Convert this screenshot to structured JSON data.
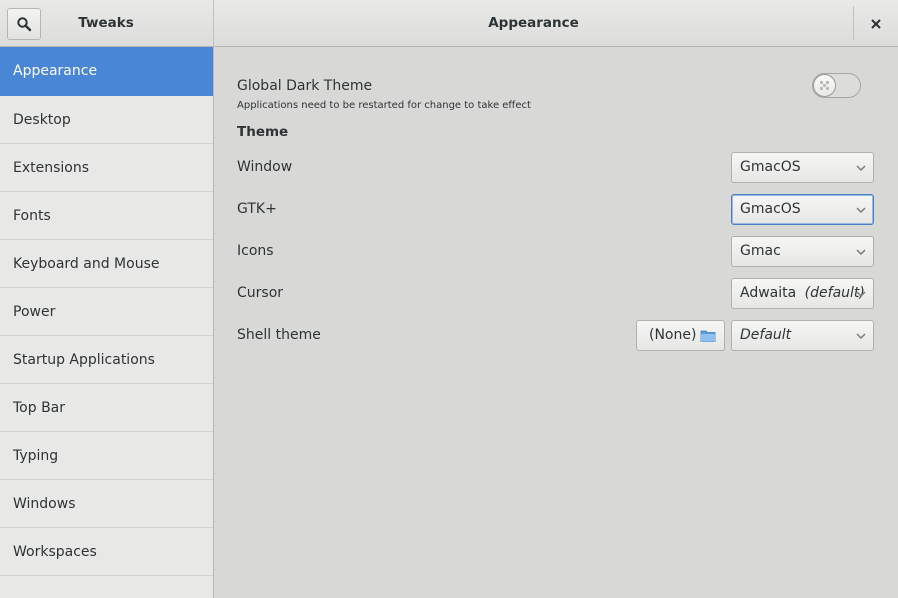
{
  "header": {
    "left_title": "Tweaks",
    "main_title": "Appearance",
    "search_icon": "search-icon",
    "close_icon": "close-icon"
  },
  "sidebar": {
    "items": [
      {
        "label": "Appearance",
        "active": true
      },
      {
        "label": "Desktop"
      },
      {
        "label": "Extensions"
      },
      {
        "label": "Fonts"
      },
      {
        "label": "Keyboard and Mouse"
      },
      {
        "label": "Power"
      },
      {
        "label": "Startup Applications"
      },
      {
        "label": "Top Bar"
      },
      {
        "label": "Typing"
      },
      {
        "label": "Windows"
      },
      {
        "label": "Workspaces"
      }
    ]
  },
  "main": {
    "dark_theme": {
      "label": "Global Dark Theme",
      "note": "Applications need to be restarted for change to take effect",
      "enabled": false
    },
    "theme_section": "Theme",
    "rows": {
      "window": {
        "label": "Window",
        "value": "GmacOS"
      },
      "gtk": {
        "label": "GTK+",
        "value": "GmacOS"
      },
      "icons": {
        "label": "Icons",
        "value": "Gmac"
      },
      "cursor": {
        "label": "Cursor",
        "value": "Adwaita",
        "suffix": "(default)"
      },
      "shell": {
        "label": "Shell theme",
        "file_button": "(None)",
        "value": "Default"
      }
    }
  },
  "colors": {
    "accent": "#4a86d6",
    "sidebar_bg": "#e8e8e7",
    "main_bg": "#d8d8d7"
  }
}
